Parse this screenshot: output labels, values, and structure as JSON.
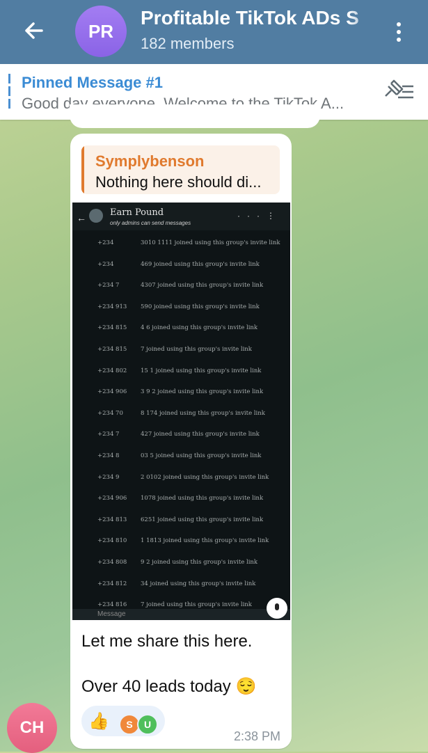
{
  "header": {
    "avatar_initials": "PR",
    "title": "Profitable TikTok ADs S",
    "subtitle": "182 members"
  },
  "pinned": {
    "title": "Pinned Message #1",
    "preview": "Good day everyone.   Welcome to the TikTok A..."
  },
  "message": {
    "reply_author": "Symplybenson",
    "reply_preview": "Nothing here should di...",
    "embedded_screenshot": {
      "chat_title": "Earn Pound",
      "chat_subtitle": "only admins can send messages",
      "input_placeholder": "Message",
      "rows": [
        {
          "phone": "+234",
          "text": "3010 1111 joined using this group's invite link"
        },
        {
          "phone": "+234",
          "text": "469 joined using this group's invite link"
        },
        {
          "phone": "+234 7",
          "text": "4307 joined using this group's invite link"
        },
        {
          "phone": "+234 913",
          "text": "590  joined using this group's invite link"
        },
        {
          "phone": "+234 815",
          "text": "4  6 joined using this group's invite link"
        },
        {
          "phone": "+234 815",
          "text": "7 joined using this group's invite link"
        },
        {
          "phone": "+234 802",
          "text": "15  1 joined using this group's invite link"
        },
        {
          "phone": "+234 906",
          "text": "3 9 2 joined using this group's invite link"
        },
        {
          "phone": "+234 70",
          "text": "8  174 joined using this group's invite link"
        },
        {
          "phone": "+234 7",
          "text": "427 joined using this group's invite link"
        },
        {
          "phone": "+234 8",
          "text": "03 5 joined using this group's invite link"
        },
        {
          "phone": "+234 9",
          "text": "2 0102 joined using this group's invite link"
        },
        {
          "phone": "+234 906",
          "text": "1078 joined using this group's invite link"
        },
        {
          "phone": "+234 813",
          "text": "6251 joined using this group's invite link"
        },
        {
          "phone": "+234 810",
          "text": "1 1813 joined using this group's invite link"
        },
        {
          "phone": "+234 808",
          "text": "9  2 joined using this group's invite link"
        },
        {
          "phone": "+234 812",
          "text": "34 joined using this group's invite link"
        },
        {
          "phone": "+234 816",
          "text": "7 joined using this group's invite link"
        }
      ]
    },
    "text_line1": "Let me share this here.",
    "text_line2": "Over 40 leads today 😌",
    "reactions": {
      "emoji": "👍",
      "user1_initial": "S",
      "user1_color": "#f0883a",
      "user2_initial": "U",
      "user2_color": "#4fbf5c"
    },
    "time": "2:38 PM",
    "sender_initials": "CH"
  },
  "colors": {
    "header_bg": "#517da2",
    "accent": "#3a8bd4",
    "reply_accent": "#e07a2e"
  }
}
